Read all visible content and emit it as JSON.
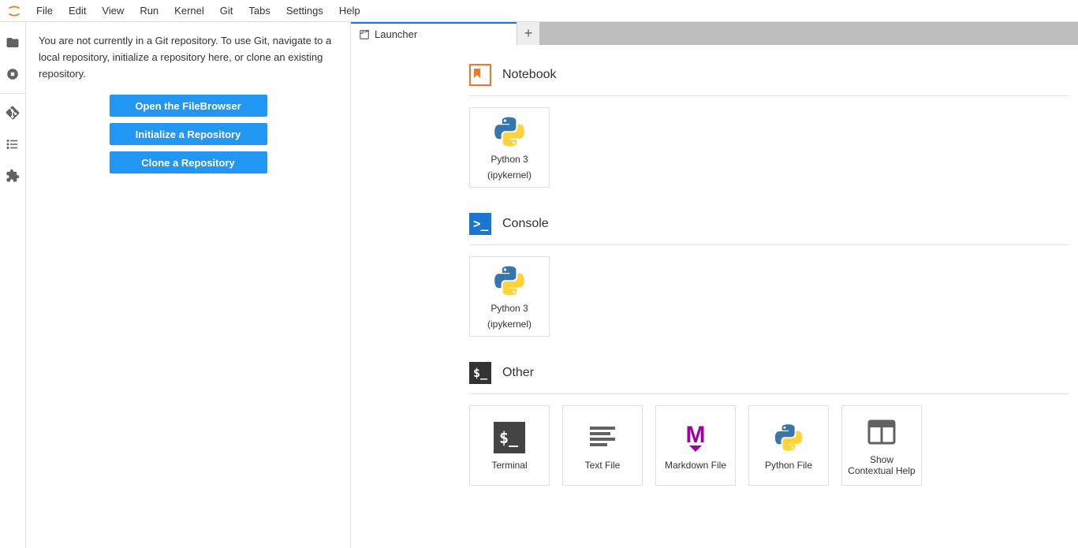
{
  "menubar": {
    "items": [
      "File",
      "Edit",
      "View",
      "Run",
      "Kernel",
      "Git",
      "Tabs",
      "Settings",
      "Help"
    ]
  },
  "activity": {
    "icons": [
      "folder",
      "running",
      "git",
      "toc",
      "extensions"
    ]
  },
  "git_panel": {
    "message": "You are not currently in a Git repository. To use Git, navigate to a local repository, initialize a repository here, or clone an existing repository.",
    "buttons": {
      "open_filebrowser": "Open the FileBrowser",
      "init_repo": "Initialize a Repository",
      "clone_repo": "Clone a Repository"
    }
  },
  "tabs": {
    "launcher": "Launcher"
  },
  "launcher": {
    "sections": {
      "notebook": {
        "title": "Notebook",
        "cards": [
          {
            "label": "Python 3",
            "sub": "(ipykernel)"
          }
        ]
      },
      "console": {
        "title": "Console",
        "cards": [
          {
            "label": "Python 3",
            "sub": "(ipykernel)"
          }
        ]
      },
      "other": {
        "title": "Other",
        "cards": [
          {
            "label": "Terminal"
          },
          {
            "label": "Text File"
          },
          {
            "label": "Markdown File"
          },
          {
            "label": "Python File"
          },
          {
            "label": "Show Contextual Help"
          }
        ]
      }
    }
  }
}
